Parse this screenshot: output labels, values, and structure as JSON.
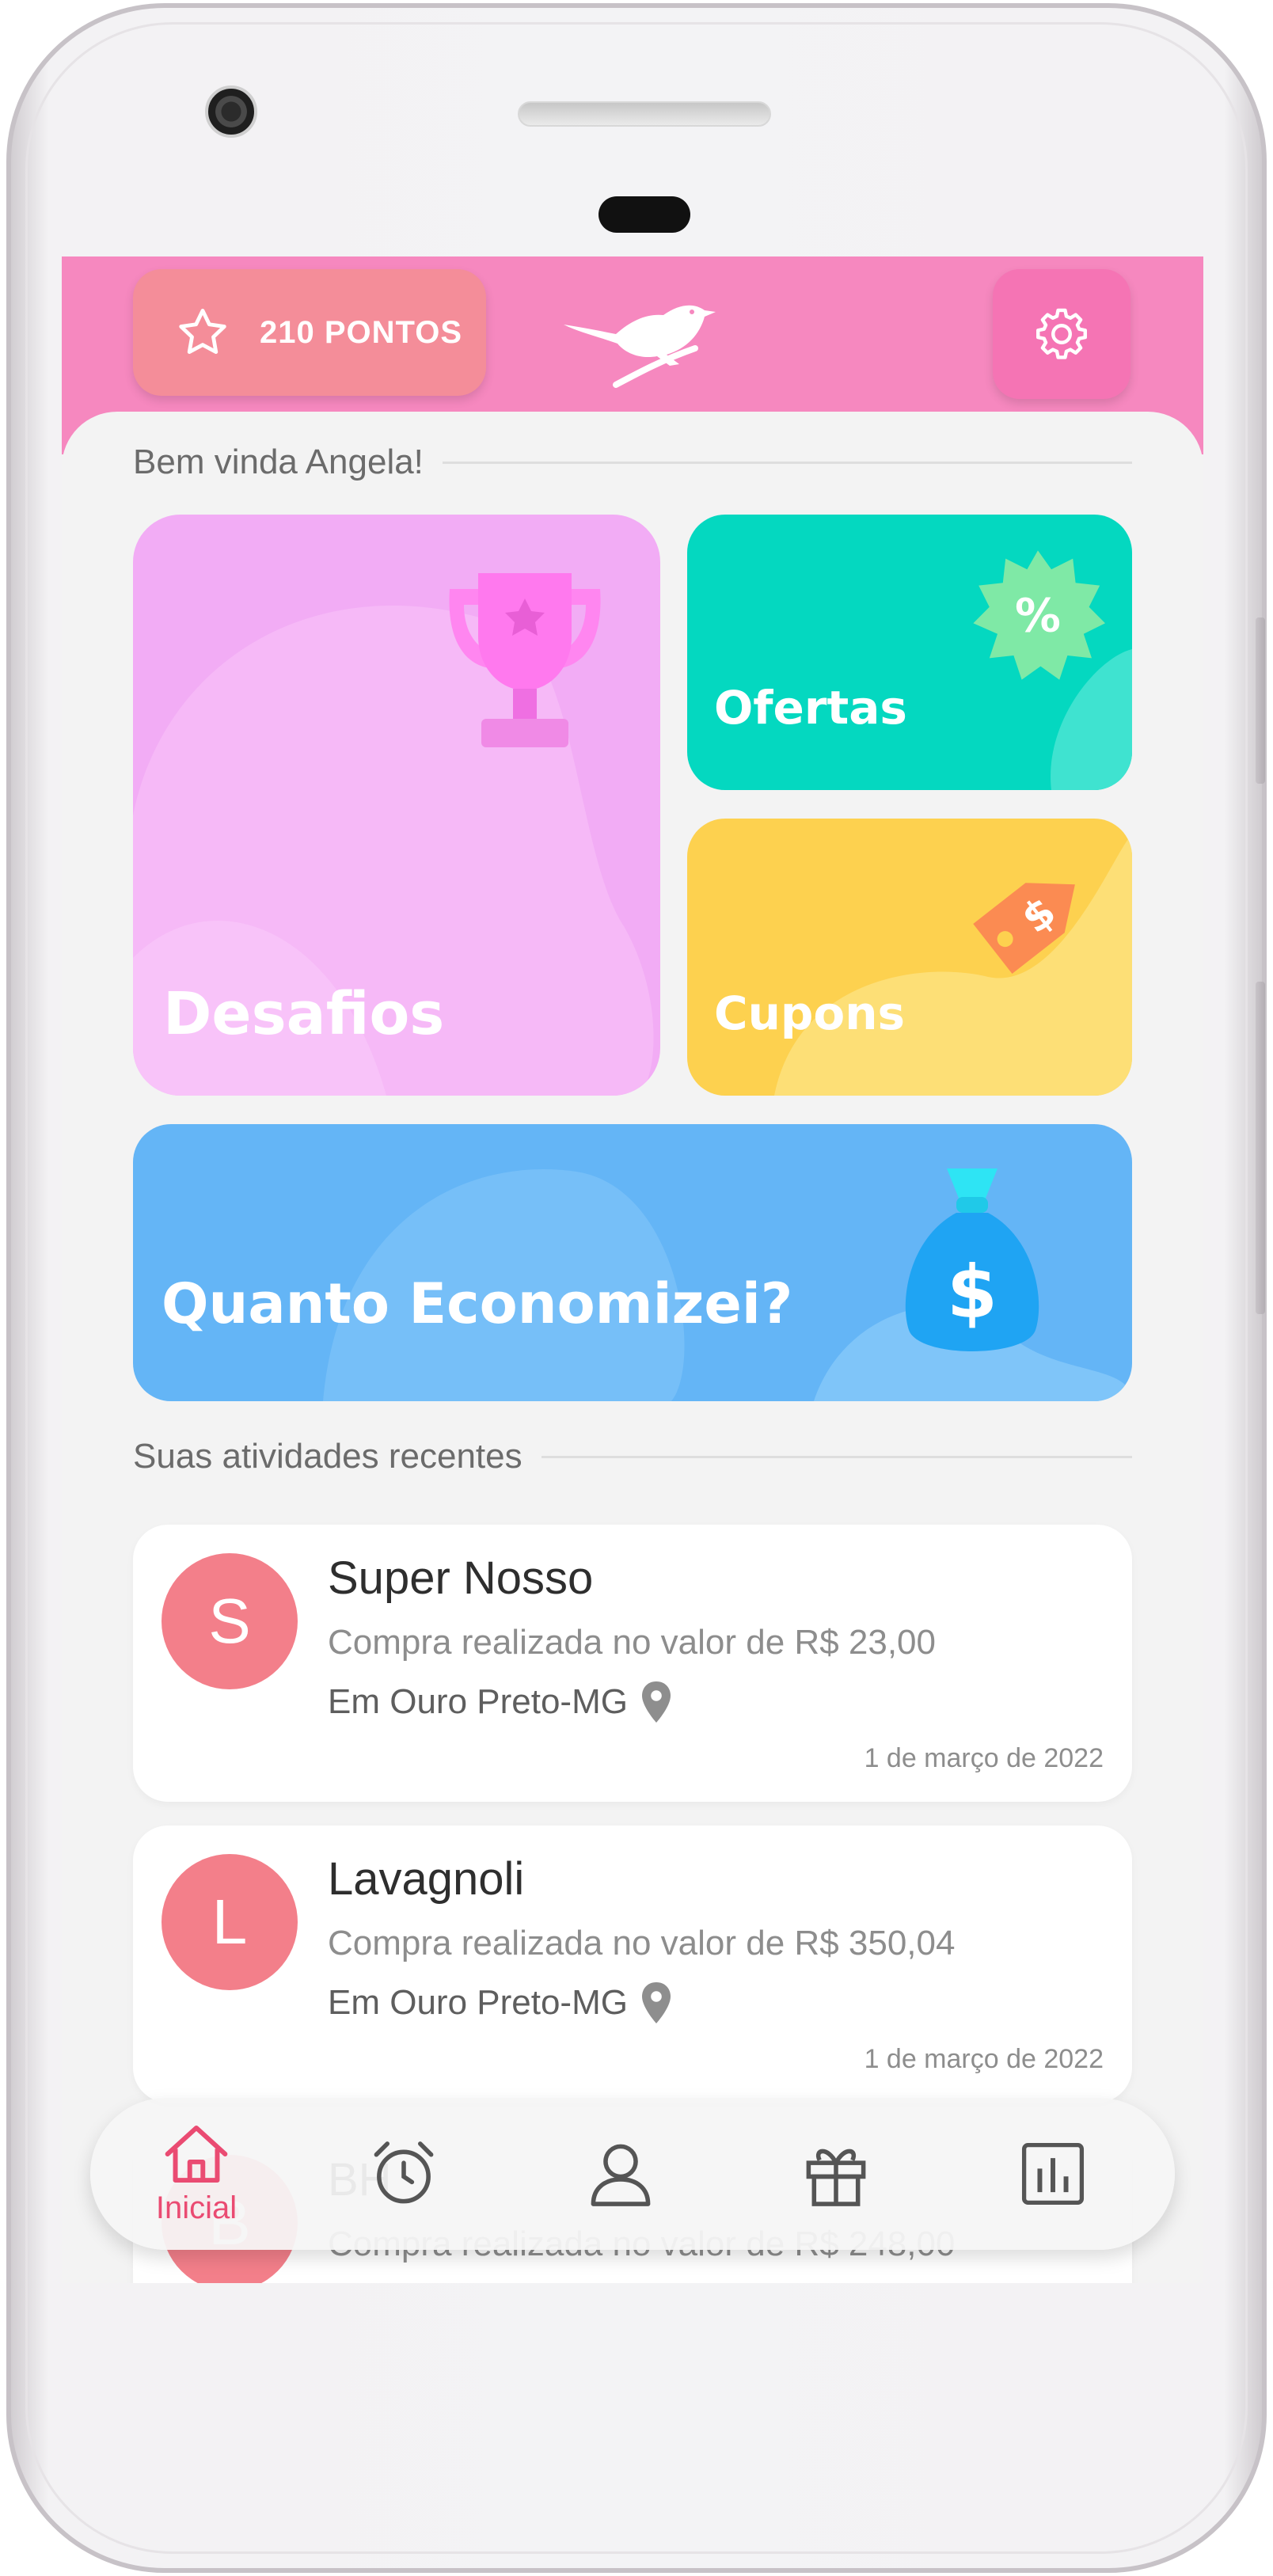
{
  "header": {
    "points_label": "210 PONTOS",
    "points_icon": "star-icon",
    "logo_icon": "bird-logo",
    "settings_icon": "gear-icon",
    "bar_color": "#f688bf",
    "pill_color": "#f48d99"
  },
  "welcome": {
    "text": "Bem vinda Angela!"
  },
  "cards": {
    "desafios": {
      "label": "Desafios",
      "color": "#f2acf5",
      "icon": "trophy-icon"
    },
    "ofertas": {
      "label": "Ofertas",
      "color": "#04d8c0",
      "icon": "percent-badge-icon"
    },
    "cupons": {
      "label": "Cupons",
      "color": "#fdd14f",
      "icon": "price-tag-icon"
    },
    "economia": {
      "label": "Quanto Economizei?",
      "color": "#64b5f6",
      "icon": "money-bag-icon"
    }
  },
  "recent": {
    "title": "Suas atividades recentes",
    "items": [
      {
        "initial": "S",
        "name": "Super Nosso",
        "description": "Compra realizada no valor de R$ 23,00",
        "location": "Em Ouro Preto-MG",
        "date": "1 de março de 2022"
      },
      {
        "initial": "L",
        "name": "Lavagnoli",
        "description": "Compra realizada no valor de R$ 350,04",
        "location": "Em Ouro Preto-MG",
        "date": "1 de março de 2022"
      },
      {
        "initial": "B",
        "name": "BH",
        "description": "Compra realizada no valor de R$ 248,00",
        "location": "",
        "date": ""
      }
    ]
  },
  "nav": {
    "home_label": "Inicial",
    "active_color": "#ea4b72",
    "icons": [
      "home-icon",
      "alarm-clock-icon",
      "user-icon",
      "gift-icon",
      "bar-chart-icon"
    ]
  }
}
